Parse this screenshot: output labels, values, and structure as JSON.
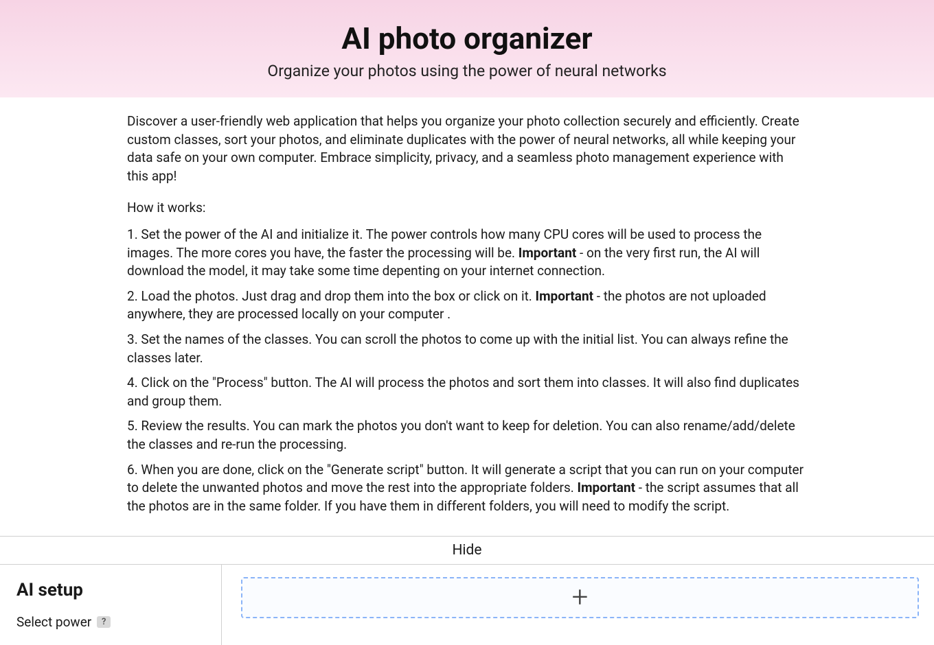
{
  "hero": {
    "title": "AI photo organizer",
    "subtitle": "Organize your photos using the power of neural networks"
  },
  "intro": "Discover a user-friendly web application that helps you organize your photo collection securely and efficiently. Create custom classes, sort your photos, and eliminate duplicates with the power of neural networks, all while keeping your data safe on your own computer. Embrace simplicity, privacy, and a seamless photo management experience with this app!",
  "how_heading": "How it works:",
  "important_label": "Important",
  "steps": [
    {
      "pre": "Set the power of the AI and initialize it. The power controls how many CPU cores will be used to process the images. The more cores you have, the faster the processing will be. ",
      "post": " - on the very first run, the AI will download the model, it may take some time depenting on your internet connection."
    },
    {
      "pre": "Load the photos. Just drag and drop them into the box or click on it. ",
      "post": " - the photos are not uploaded anywhere, they are processed locally on your computer ."
    },
    {
      "pre": "Set the names of the classes. You can scroll the photos to come up with the initial list. You can always refine the classes later.",
      "post": ""
    },
    {
      "pre": "Click on the \"Process\" button. The AI will process the photos and sort them into classes. It will also find duplicates and group them.",
      "post": ""
    },
    {
      "pre": "Review the results. You can mark the photos you don't want to keep for deletion. You can also rename/add/delete the classes and re-run the processing.",
      "post": ""
    },
    {
      "pre": "When you are done, click on the \"Generate script\" button. It will generate a script that you can run on your computer to delete the unwanted photos and move the rest into the appropriate folders. ",
      "post": " - the script assumes that all the photos are in the same folder. If you have them in different folders, you will need to modify the script."
    }
  ],
  "hide_label": "Hide",
  "sidebar": {
    "title": "AI setup",
    "select_power_label": "Select power",
    "help_glyph": "?"
  },
  "icons": {
    "plus": "+"
  }
}
